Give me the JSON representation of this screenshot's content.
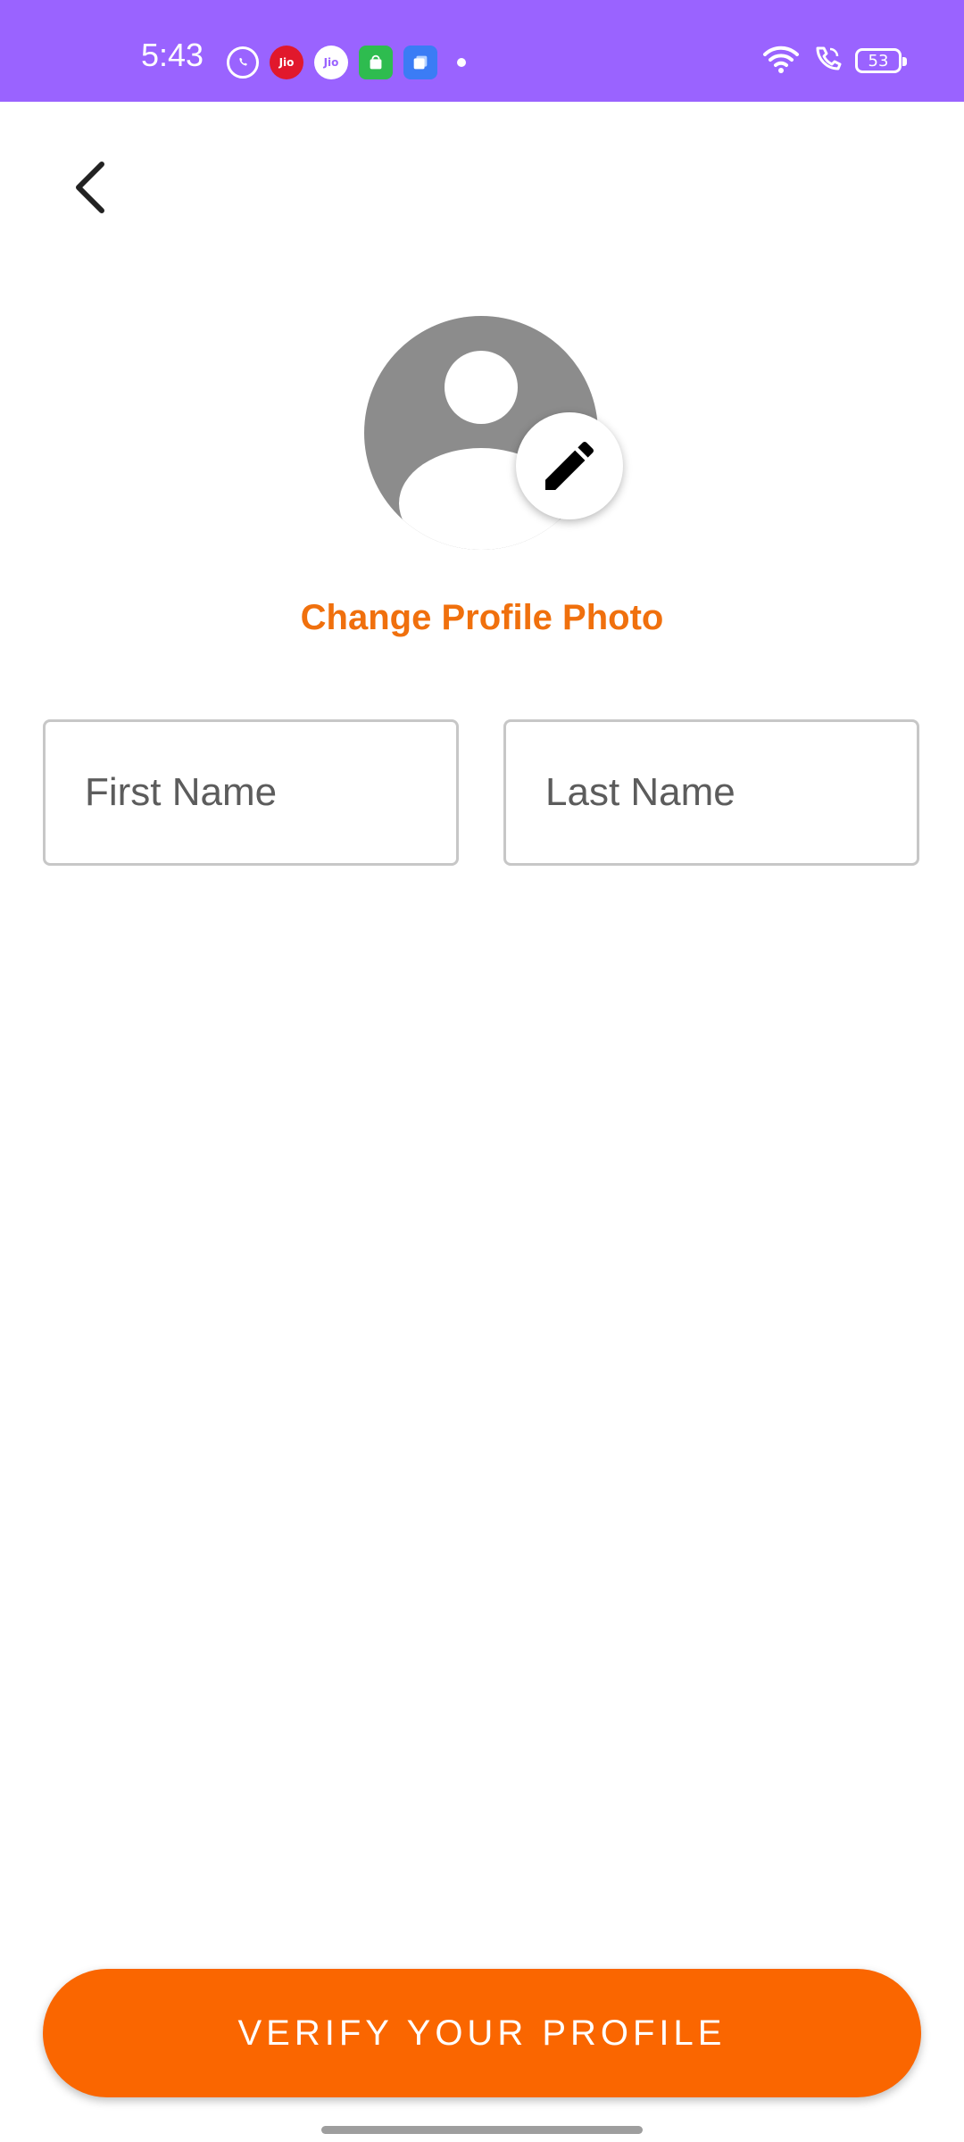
{
  "status_bar": {
    "time": "5:43",
    "background_color": "#9a63ff",
    "notifications": [
      {
        "name": "whatsapp-icon",
        "label": ""
      },
      {
        "name": "jio-red-icon",
        "label": "Jio"
      },
      {
        "name": "jio-white-icon",
        "label": "Jio"
      },
      {
        "name": "green-app-icon",
        "label": ""
      },
      {
        "name": "blue-app-icon",
        "label": ""
      }
    ],
    "system_icons": [
      "wifi-icon",
      "wifi-call-icon",
      "battery-icon"
    ],
    "battery_level": "53"
  },
  "header": {
    "back_icon": "chevron-left-icon"
  },
  "profile": {
    "avatar_icon": "person-placeholder-icon",
    "edit_icon": "pencil-icon",
    "change_photo_label": "Change Profile Photo",
    "accent_color": "#f0700d"
  },
  "form": {
    "first_name": {
      "value": "",
      "placeholder": "First Name"
    },
    "last_name": {
      "value": "",
      "placeholder": "Last Name"
    }
  },
  "actions": {
    "verify_label": "VERIFY YOUR PROFILE",
    "verify_color": "#fa6600"
  }
}
